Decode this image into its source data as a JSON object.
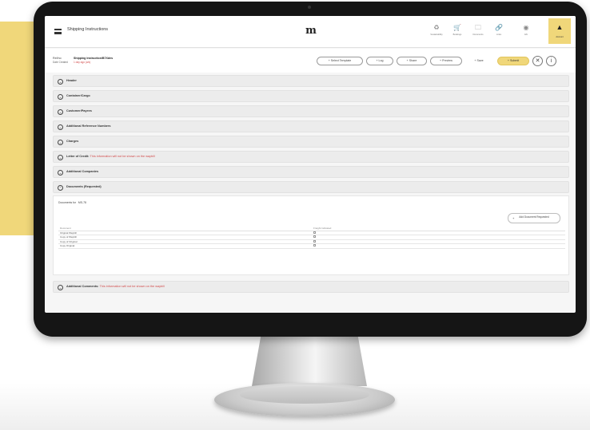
{
  "app": {
    "title": "Shipping Instructions",
    "logo": "m",
    "toolbar": [
      {
        "icon": "recycle-icon",
        "glyph": "♻",
        "label": "Sustainability"
      },
      {
        "icon": "cart-icon",
        "glyph": "🛒",
        "label": "Bookings"
      },
      {
        "icon": "folder-icon",
        "glyph": "🗀",
        "label": "Documents"
      },
      {
        "icon": "link-icon",
        "glyph": "🔗",
        "label": "Links"
      },
      {
        "icon": "globe-icon",
        "glyph": "◉",
        "label": "EN"
      }
    ],
    "profile": {
      "icon": "user-icon",
      "glyph": "▲",
      "label": "Account"
    }
  },
  "subheader": {
    "ref_label": "Ref/no",
    "ref_value": "Shipping Instruction/B7Xdes",
    "status_label": "Date Created",
    "status_value": "1 day ago (a/s)",
    "actions": {
      "select_template": "+ Select Template",
      "log": "+ Log",
      "share": "+ Share",
      "preview": "+ Preview",
      "save": "+ Save",
      "submit": "+ Submit"
    }
  },
  "sections": [
    {
      "label": "Header",
      "note": "",
      "state": "collapsed"
    },
    {
      "label": "Container/Cargo",
      "note": "",
      "state": "collapsed"
    },
    {
      "label": "Customer/Payees",
      "note": "",
      "state": "collapsed"
    },
    {
      "label": "Additional Reference Numbers",
      "note": "",
      "state": "collapsed"
    },
    {
      "label": "Charges",
      "note": "",
      "state": "collapsed"
    },
    {
      "label": "Letter of Credit",
      "note": "This information will not be shown on the waybill",
      "state": "collapsed"
    },
    {
      "label": "Additional Companies",
      "note": "",
      "state": "collapsed"
    },
    {
      "label": "Documents (Requested)",
      "note": "",
      "state": "expanded"
    }
  ],
  "documents": {
    "for_label": "Documents for",
    "for_value": "MS-78",
    "add_button": "Add Document Requested",
    "columns": [
      "Document",
      "Freight Indicated"
    ],
    "rows": [
      {
        "name": "Original Waybill",
        "checked": false
      },
      {
        "name": "Copy of Waybill",
        "checked": false
      },
      {
        "name": "Copy of Original",
        "checked": false
      },
      {
        "name": "Copy Original",
        "checked": false
      }
    ]
  },
  "footer_section": {
    "label": "Additional Comments",
    "note": "This information will not be shown on the waybill",
    "state": "collapsed"
  }
}
